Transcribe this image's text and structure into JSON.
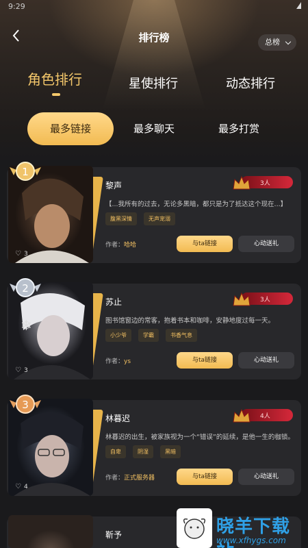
{
  "status_bar": {
    "time": "9:29"
  },
  "header": {
    "title": "排行榜",
    "range_select": "总榜"
  },
  "main_tabs": [
    {
      "label": "角色排行",
      "active": true
    },
    {
      "label": "星使排行",
      "active": false
    },
    {
      "label": "动态排行",
      "active": false
    }
  ],
  "sub_tabs": [
    {
      "label": "最多链接",
      "active": true
    },
    {
      "label": "最多聊天",
      "active": false
    },
    {
      "label": "最多打赏",
      "active": false
    }
  ],
  "cards": [
    {
      "rank": "1",
      "name": "黎声",
      "heat": "3人",
      "description": "【...我所有的过去，无论多黑暗，都只是为了抵达这个现在...】",
      "tags": [
        "腹黑深情",
        "无声宠溺"
      ],
      "author_label": "作者：",
      "author": "哈哈",
      "likes": "3",
      "link_btn": "与ta链接",
      "gift_btn": "心动送礼"
    },
    {
      "rank": "2",
      "name": "苏止",
      "heat": "3人",
      "description": "图书馆窗边的常客，抱着书本和咖啡，安静地度过每一天。",
      "tags": [
        "小少爷",
        "学霸",
        "书香气息"
      ],
      "author_label": "作者：",
      "author": "ys",
      "likes": "3",
      "link_btn": "与ta链接",
      "gift_btn": "心动送礼"
    },
    {
      "rank": "3",
      "name": "林暮迟",
      "heat": "4人",
      "description": "林暮迟的出生，被家族视为一个“错误”的延续，是他一生的枷锁。",
      "tags": [
        "自卑",
        "阴湿",
        "黑暗"
      ],
      "author_label": "作者：",
      "author": "正式服务器",
      "likes": "4",
      "link_btn": "与ta链接",
      "gift_btn": "心动送礼"
    },
    {
      "name": "靳予",
      "heat": "",
      "likes": ""
    }
  ],
  "watermark": {
    "text": "晓羊下载站",
    "url": "www.xfhygs.com"
  },
  "colors": {
    "accent": "#f5c86b",
    "gold": "#e8b44a",
    "heat": "#d5283a",
    "card_bg": "#28282b"
  }
}
